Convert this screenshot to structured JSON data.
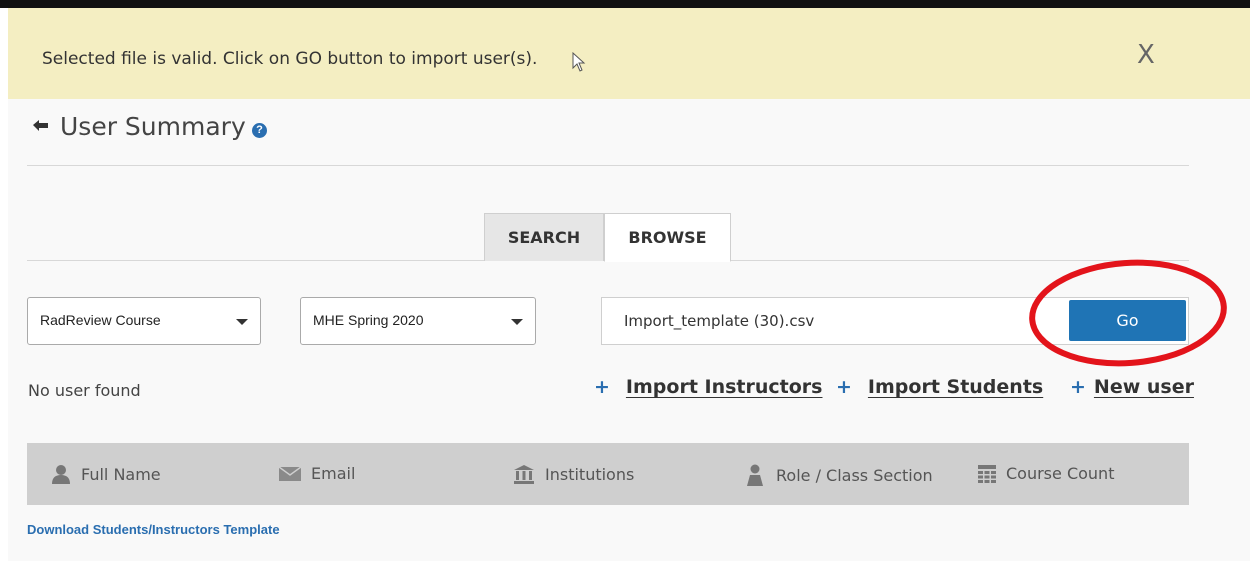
{
  "notice": {
    "message": "Selected file is valid. Click on GO button to import user(s).",
    "close_label": "X"
  },
  "header": {
    "title": "User Summary",
    "help_label": "?"
  },
  "tabs": [
    {
      "label": "SEARCH"
    },
    {
      "label": "BROWSE"
    }
  ],
  "filters": {
    "course": "RadReview Course",
    "section": "MHE Spring 2020",
    "file": "Import_template (30).csv",
    "go_label": "Go"
  },
  "status": {
    "no_user": "No user found"
  },
  "actions": {
    "plus": "+",
    "import_instructors": "Import Instructors",
    "import_students": "Import Students",
    "new_user": "New user"
  },
  "table": {
    "columns": [
      "Full Name",
      "Email",
      "Institutions",
      "Role / Class Section",
      "Course Count"
    ]
  },
  "footer": {
    "download_link": "Download Students/Instructors Template"
  },
  "colors": {
    "notice_bg": "#f4eec2",
    "accent": "#1f74b5",
    "highlight_ring": "#e3141b"
  }
}
